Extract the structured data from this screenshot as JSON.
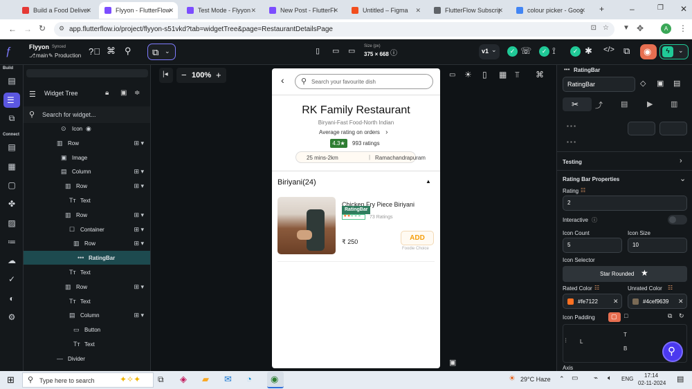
{
  "browser": {
    "tabs": [
      {
        "label": "Build a Food Deliver",
        "color": "#e53935"
      },
      {
        "label": "Flyyon - FlutterFlow",
        "color": "#7c4dff"
      },
      {
        "label": "Test Mode - Flyyon",
        "color": "#7c4dff"
      },
      {
        "label": "New Post - FlutterFl",
        "color": "#7c4dff"
      },
      {
        "label": "Untitled – Figma",
        "color": "#f24e1e"
      },
      {
        "label": "FlutterFlow Subscrip",
        "color": "#5f6368"
      },
      {
        "label": "colour picker - Goog",
        "color": "#4285f4"
      }
    ],
    "url": "app.flutterflow.io/project/flyyon-s51vkd?tab=widgetTree&page=RestaurantDetailsPage",
    "profile": "A"
  },
  "toolbar": {
    "project_name": "Flyyon",
    "synced": "Synced",
    "branch": "main",
    "env": "Production",
    "size_label": "Size (px)",
    "size_value": "375 × 668",
    "version": "v1"
  },
  "rail": {
    "build_label": "Build",
    "connect_label": "Connect"
  },
  "tree": {
    "title": "Widget Tree",
    "search_placeholder": "Search for widget...",
    "rows": [
      {
        "label": "Icon",
        "indent": 54,
        "icon": "⊙"
      },
      {
        "label": "Row",
        "indent": 48,
        "icon": "▥"
      },
      {
        "label": "Image",
        "indent": 54,
        "icon": "▣"
      },
      {
        "label": "Column",
        "indent": 54,
        "icon": "▤"
      },
      {
        "label": "Row",
        "indent": 60,
        "icon": "▥"
      },
      {
        "label": "Text",
        "indent": 66,
        "icon": "Tт"
      },
      {
        "label": "Row",
        "indent": 60,
        "icon": "▥"
      },
      {
        "label": "Container",
        "indent": 66,
        "icon": "☐"
      },
      {
        "label": "Row",
        "indent": 72,
        "icon": "▥"
      },
      {
        "label": "RatingBar",
        "indent": 78,
        "icon": "•••"
      },
      {
        "label": "Text",
        "indent": 66,
        "icon": "Tт"
      },
      {
        "label": "Row",
        "indent": 60,
        "icon": "▥"
      },
      {
        "label": "Text",
        "indent": 66,
        "icon": "Tт"
      },
      {
        "label": "Column",
        "indent": 66,
        "icon": "▤"
      },
      {
        "label": "Button",
        "indent": 72,
        "icon": "▭"
      },
      {
        "label": "Text",
        "indent": 72,
        "icon": "Tт"
      },
      {
        "label": "Divider",
        "indent": 48,
        "icon": "—"
      }
    ]
  },
  "canvas": {
    "zoom": "100%"
  },
  "app": {
    "search_placeholder": "Search your favourite dish",
    "restaurant_name": "RK Family Restaurant",
    "cuisines": "Biryani-Fast Food-North Indian",
    "avg_rating_label": "Average rating on orders",
    "rating": "4.3★",
    "ratings_count": "993 ratings",
    "eta": "25 mins-2km",
    "location": "Ramachandrapuram",
    "section_title": "Biriyani(24)",
    "dish_name": "Chicken Fry Piece Biriyani",
    "tag": "RatingBar",
    "dish_ratings": "73 Ratings",
    "price": "₹ 250",
    "add_label": "ADD",
    "badge": "Foodie Choice"
  },
  "props": {
    "widget_type": "RatingBar",
    "widget_name": "RatingBar",
    "testing": "Testing",
    "section_title": "Rating Bar Properties",
    "rating_label": "Rating",
    "rating_value": "2",
    "interactive_label": "Interactive",
    "icon_count_label": "Icon Count",
    "icon_count": "5",
    "icon_size_label": "Icon Size",
    "icon_size": "10",
    "icon_selector_label": "Icon Selector",
    "icon_selector_value": "Star Rounded",
    "rated_color_label": "Rated Color",
    "rated_color": "#fe7122",
    "unrated_color_label": "Unrated Color",
    "unrated_color": "#4cef9639",
    "icon_padding_label": "Icon Padding",
    "pad_l": "L",
    "pad_t": "T",
    "pad_b": "B",
    "axis_label": "Axis"
  },
  "taskbar": {
    "search_placeholder": "Type here to search",
    "weather": "29°C  Haze",
    "lang": "ENG",
    "time": "17:14",
    "date": "02-11-2024"
  }
}
